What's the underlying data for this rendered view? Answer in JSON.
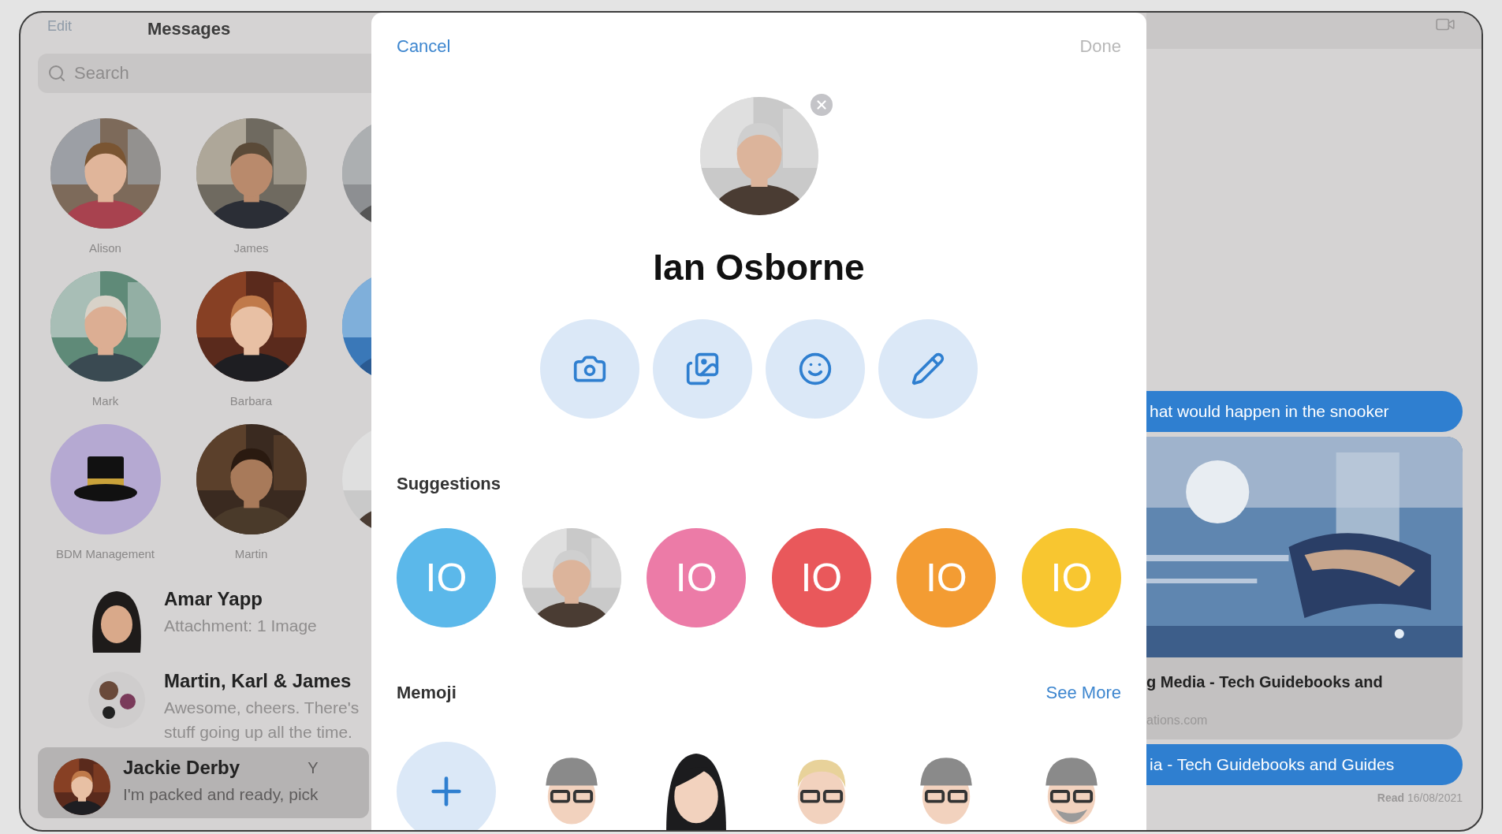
{
  "sidebar": {
    "edit": "Edit",
    "title": "Messages",
    "search": {
      "placeholder": "Search"
    },
    "pinned": [
      {
        "name": "Alison",
        "kind": "picture"
      },
      {
        "name": "James",
        "kind": "picture"
      },
      {
        "kind": "picture"
      },
      {
        "name": "Mark",
        "kind": "picture"
      },
      {
        "name": "Barbara",
        "kind": "picture"
      },
      {
        "kind": "picture"
      },
      {
        "name": "BDM Management",
        "kind": "hat"
      },
      {
        "name": "Martin",
        "kind": "picture"
      },
      {
        "kind": "picture"
      }
    ],
    "conversations": [
      {
        "name": "Amar Yapp",
        "preview_lines": [
          "Attachment: 1 Image"
        ],
        "kind": "memoji",
        "selected": false
      },
      {
        "name": "Martin, Karl & James",
        "preview_lines": [
          "Awesome, cheers. There's",
          "stuff going up all the time."
        ],
        "kind": "group",
        "selected": false
      },
      {
        "name": "Jackie Derby",
        "time": "Y",
        "preview_lines": [
          "I'm packed and ready, pick"
        ],
        "kind": "picture",
        "selected": true
      }
    ]
  },
  "sheet": {
    "cancel": "Cancel",
    "done": {
      "label": "Done",
      "disabled": true
    },
    "name": "Ian Osborne",
    "actions": [
      {
        "kind": "camera"
      },
      {
        "kind": "photos"
      },
      {
        "kind": "emoji"
      },
      {
        "kind": "pencil"
      }
    ],
    "suggestions_label": "Suggestions",
    "suggestions": [
      {
        "kind": "initials",
        "text": "IO",
        "color": "#5bb8ea"
      },
      {
        "kind": "picture"
      },
      {
        "kind": "initials",
        "text": "IO",
        "color": "#ec7ba7"
      },
      {
        "kind": "initials",
        "text": "IO",
        "color": "#e9585b"
      },
      {
        "kind": "initials",
        "text": "IO",
        "color": "#f39c33"
      },
      {
        "kind": "initials",
        "text": "IO",
        "color": "#f8c630"
      }
    ],
    "memoji_label": "Memoji",
    "see_more": "See More",
    "memoji": [
      {
        "kind": "add"
      },
      {
        "kind": "cap"
      },
      {
        "kind": "long-hair"
      },
      {
        "kind": "short-hair"
      },
      {
        "kind": "cap"
      },
      {
        "kind": "cap-beard"
      }
    ]
  },
  "chat": {
    "messages": [
      {
        "kind": "bubble",
        "text": "hat would happen in the snooker"
      },
      {
        "kind": "link",
        "title": "g Media - Tech Guidebooks and",
        "domain": "ations.com"
      },
      {
        "kind": "bubble",
        "text": "ia - Tech Guidebooks and Guides"
      }
    ],
    "receipt": "**Read** 16/08/2021"
  }
}
